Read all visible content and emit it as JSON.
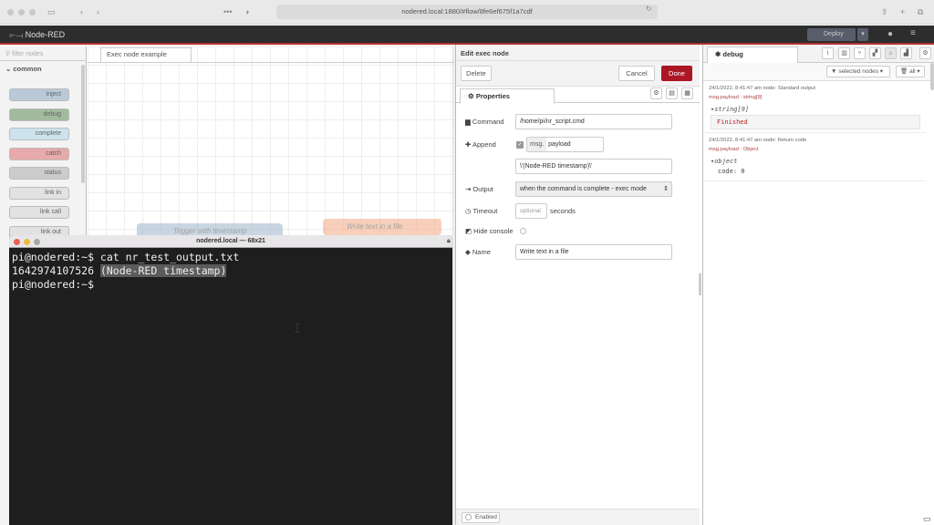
{
  "browser": {
    "url": "nodered.local:1880/#flow/8fe6ef675f1a7cdf"
  },
  "nodered": {
    "app_title": "Node-RED",
    "deploy_label": "Deploy"
  },
  "palette": {
    "filter_placeholder": "filter nodes",
    "category": "common",
    "nodes": [
      {
        "label": "inject",
        "color": "#a6bbcf"
      },
      {
        "label": "debug",
        "color": "#87a980"
      },
      {
        "label": "complete",
        "color": "#c0deed"
      },
      {
        "label": "catch",
        "color": "#e49191"
      },
      {
        "label": "status",
        "color": "#c0c0c0"
      },
      {
        "label": "link in",
        "color": "#dddddd"
      },
      {
        "label": "link call",
        "color": "#dddddd"
      },
      {
        "label": "link out",
        "color": "#dddddd"
      }
    ]
  },
  "workspace": {
    "tab_label": "Exec node example",
    "node1_label": "Trigger with timestamp",
    "node2_label": "Write text in a file"
  },
  "terminal": {
    "title": "nodered.local — 68x21",
    "line1": "pi@nodered:~$ cat nr_test_output.txt",
    "line2_a": "1642974107526 ",
    "line2_b": "(Node-RED timestamp)",
    "line3": "pi@nodered:~$"
  },
  "edit": {
    "title": "Edit exec node",
    "delete_label": "Delete",
    "cancel_label": "Cancel",
    "done_label": "Done",
    "properties_tab": "Properties",
    "command_label": "Command",
    "command_value": "/home/pi/nr_script.cmd",
    "append_label": "Append",
    "append_type": "msg.",
    "append_value": "payload",
    "extra_value": "\\'(Node-RED timestamp)\\'",
    "output_label": "Output",
    "output_value": "when the command is complete - exec mode",
    "timeout_label": "Timeout",
    "timeout_placeholder": "optional",
    "timeout_unit": "seconds",
    "hide_console_label": "Hide console",
    "name_label": "Name",
    "name_value": "Write text in a file",
    "enabled_label": "Enabled"
  },
  "debug": {
    "tab_label": "debug",
    "filter_label": "selected nodes",
    "clear_label": "all",
    "messages": [
      {
        "meta": "24/1/2022, 8:41:47 am    node: Standard output",
        "topic": "msg.payload : string[9]",
        "type": "string[9]",
        "value": "Finished"
      },
      {
        "meta": "24/1/2022, 8:41:47 am    node: Return code",
        "topic": "msg.payload : Object",
        "type": "object",
        "value": "code: 0"
      }
    ]
  }
}
